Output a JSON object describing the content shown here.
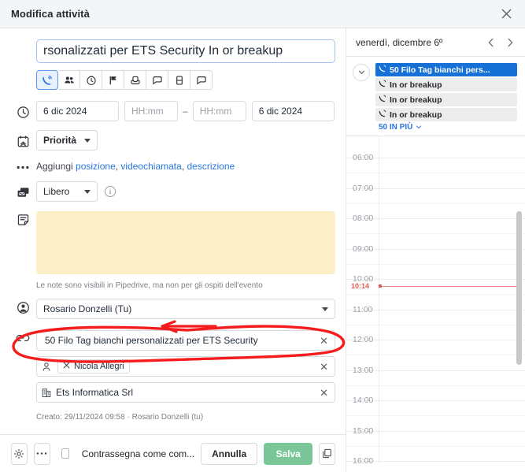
{
  "window": {
    "title": "Modifica attività",
    "close_icon": "close-icon"
  },
  "form": {
    "title_field": {
      "value": "rsonalizzati per ETS Security In or breakup",
      "icon": "text-input"
    },
    "activity_types": [
      {
        "name": "call-type",
        "icon": "phone-icon",
        "active": true
      },
      {
        "name": "meeting-type",
        "icon": "people-icon",
        "active": false
      },
      {
        "name": "task-type",
        "icon": "clock-icon",
        "active": false
      },
      {
        "name": "deadline-type",
        "icon": "flag-icon",
        "active": false
      },
      {
        "name": "email-type",
        "icon": "inbox-icon",
        "active": false
      },
      {
        "name": "lunch-type",
        "icon": "chat-icon",
        "active": false
      },
      {
        "name": "document-type",
        "icon": "book-icon",
        "active": false
      },
      {
        "name": "message-type",
        "icon": "chat-alt-icon",
        "active": false
      }
    ],
    "schedule": {
      "icon": "clock-icon",
      "start_date": "6 dic 2024",
      "start_time_placeholder": "HH:mm",
      "start_time_value": "",
      "separator": "–",
      "end_time_placeholder": "HH:mm",
      "end_time_value": "",
      "end_date": "6 dic 2024"
    },
    "priority": {
      "icon": "calendar-priority-icon",
      "label": "Priorità"
    },
    "add_more": {
      "icon": "ellipsis-icon",
      "prefix": "Aggiungi ",
      "links": [
        "posizione",
        "videochiamata",
        "descrizione"
      ],
      "separator": ", "
    },
    "availability": {
      "icon": "busy-free-icon",
      "value": "Libero",
      "info_icon": "info-icon"
    },
    "note": {
      "icon": "note-icon",
      "value": "",
      "placeholder": "",
      "hint": "Le note sono visibili in Pipedrive, ma non per gli ospiti dell'evento"
    },
    "owner": {
      "icon": "user-circle-icon",
      "value": "Rosario Donzelli (Tu)",
      "dropdown_icon": "chevron-down-icon"
    },
    "links": {
      "icon": "link-icon",
      "items": [
        {
          "name": "deal-link",
          "icon": "",
          "text": "50 Filo Tag bianchi personalizzati per ETS Security",
          "clear_icon": "close-icon",
          "chip": false
        },
        {
          "name": "person-link",
          "icon": "person-icon",
          "text": "Nicola Allegri",
          "clear_icon": "close-icon",
          "chip": true,
          "chip_icon": "person-x-icon"
        },
        {
          "name": "organization-link",
          "icon": "building-icon",
          "text": "Ets Informatica Srl",
          "clear_icon": "close-icon",
          "chip": false
        }
      ]
    },
    "created_line": "Creato: 29/11/2024 09:58 · Rosario Donzelli (tu)"
  },
  "footer": {
    "settings_icon": "gear-icon",
    "more_icon": "ellipsis-icon",
    "done_checkbox_label": "Contrassegna come com...",
    "done_checked": false,
    "cancel_label": "Annulla",
    "save_label": "Salva",
    "duplicate_icon": "copy-icon"
  },
  "calendar": {
    "date_label": "venerdì, dicembre 6º",
    "prev_icon": "chevron-left-icon",
    "next_icon": "chevron-right-icon",
    "collapse_icon": "chevron-down-icon",
    "events": [
      {
        "icon": "phone-icon",
        "label": "50 Filo Tag bianchi pers...",
        "selected": true
      },
      {
        "icon": "phone-icon",
        "label": "In or breakup",
        "selected": false
      },
      {
        "icon": "phone-icon",
        "label": "In or breakup",
        "selected": false
      },
      {
        "icon": "phone-icon",
        "label": "In or breakup",
        "selected": false
      }
    ],
    "more_label": "50 IN PIÙ",
    "more_icon": "chevron-down-icon",
    "hours": [
      "06:00",
      "07:00",
      "08:00",
      "09:00",
      "10:00",
      "11:00",
      "12:00",
      "13:00",
      "14:00",
      "15:00",
      "16:00"
    ],
    "current_time": "10:14"
  },
  "colors": {
    "accent_blue": "#2a77e0",
    "selected_event": "#1670d6",
    "save_green": "#7ac698",
    "note_yellow": "#fdefc8",
    "now_red": "#e05c54",
    "annotation_red": "#f41c1c"
  }
}
